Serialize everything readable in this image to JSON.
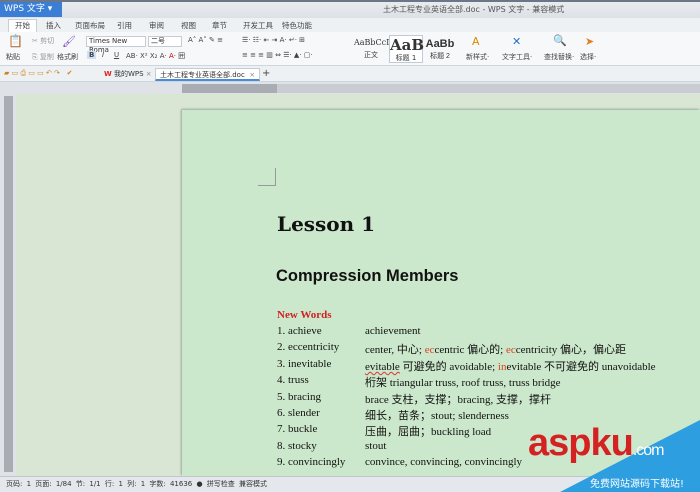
{
  "app": {
    "name": "WPS 文字",
    "title": "土木工程专业英语全部.doc - WPS 文字 - 兼容模式"
  },
  "tabs": [
    "开始",
    "插入",
    "页面布局",
    "引用",
    "审阅",
    "视图",
    "章节",
    "开发工具",
    "特色功能"
  ],
  "ribbon": {
    "paste": "粘贴",
    "cut": "剪切",
    "copy": "复制",
    "format_painter": "格式刷",
    "font": "Times New Roma",
    "size": "二号",
    "bold": "B",
    "italic": "I",
    "underline": "U",
    "styles": [
      {
        "preview": "AaBbCcD",
        "label": "正文"
      },
      {
        "preview": "AaB",
        "label": "标题 1"
      },
      {
        "preview": "AaBb",
        "label": "标题 2"
      }
    ],
    "new_style": "新样式",
    "text_tools": "文字工具",
    "find_replace": "查找替换",
    "select": "选择"
  },
  "doc_tabs": [
    {
      "label": "我的WPS"
    },
    {
      "label": "土木工程专业英语全部.doc"
    }
  ],
  "document": {
    "heading": "Lesson 1",
    "subheading": "Compression Members",
    "section": "New Words",
    "words": [
      {
        "term": "1. achieve",
        "def": "achievement"
      },
      {
        "term": "2. eccentricity",
        "def": "center, 中心; eccentric 偏心的; eccentricity 偏心，偏心距"
      },
      {
        "term": "3. inevitable",
        "def": "evitable 可避免的 avoidable; inevitable 不可避免的 unavoidable"
      },
      {
        "term": "4. truss",
        "def": "桁架 triangular truss, roof truss, truss bridge"
      },
      {
        "term": "5. bracing",
        "def": "brace 支柱，支撑；bracing, 支撑，撑杆"
      },
      {
        "term": "6. slender",
        "def": "细长，苗条；stout; slenderness"
      },
      {
        "term": "7. buckle",
        "def": "压曲，屈曲；buckling load"
      },
      {
        "term": "8. stocky",
        "def": "stout"
      },
      {
        "term": "9. convincingly",
        "def": "convince, convincing, convincingly"
      }
    ]
  },
  "status": "页码: 1  页面: 1/84  节: 1/1  行: 1  列: 1  字数: 41636  ● 拼写检查  兼容模式",
  "watermark": {
    "logo": "aspku",
    "domain": ".com",
    "sub": "免费网站源码下载站!"
  },
  "colors": {
    "accent": "#3a7fd5",
    "page": "#cce8cc",
    "red": "#d02020"
  }
}
